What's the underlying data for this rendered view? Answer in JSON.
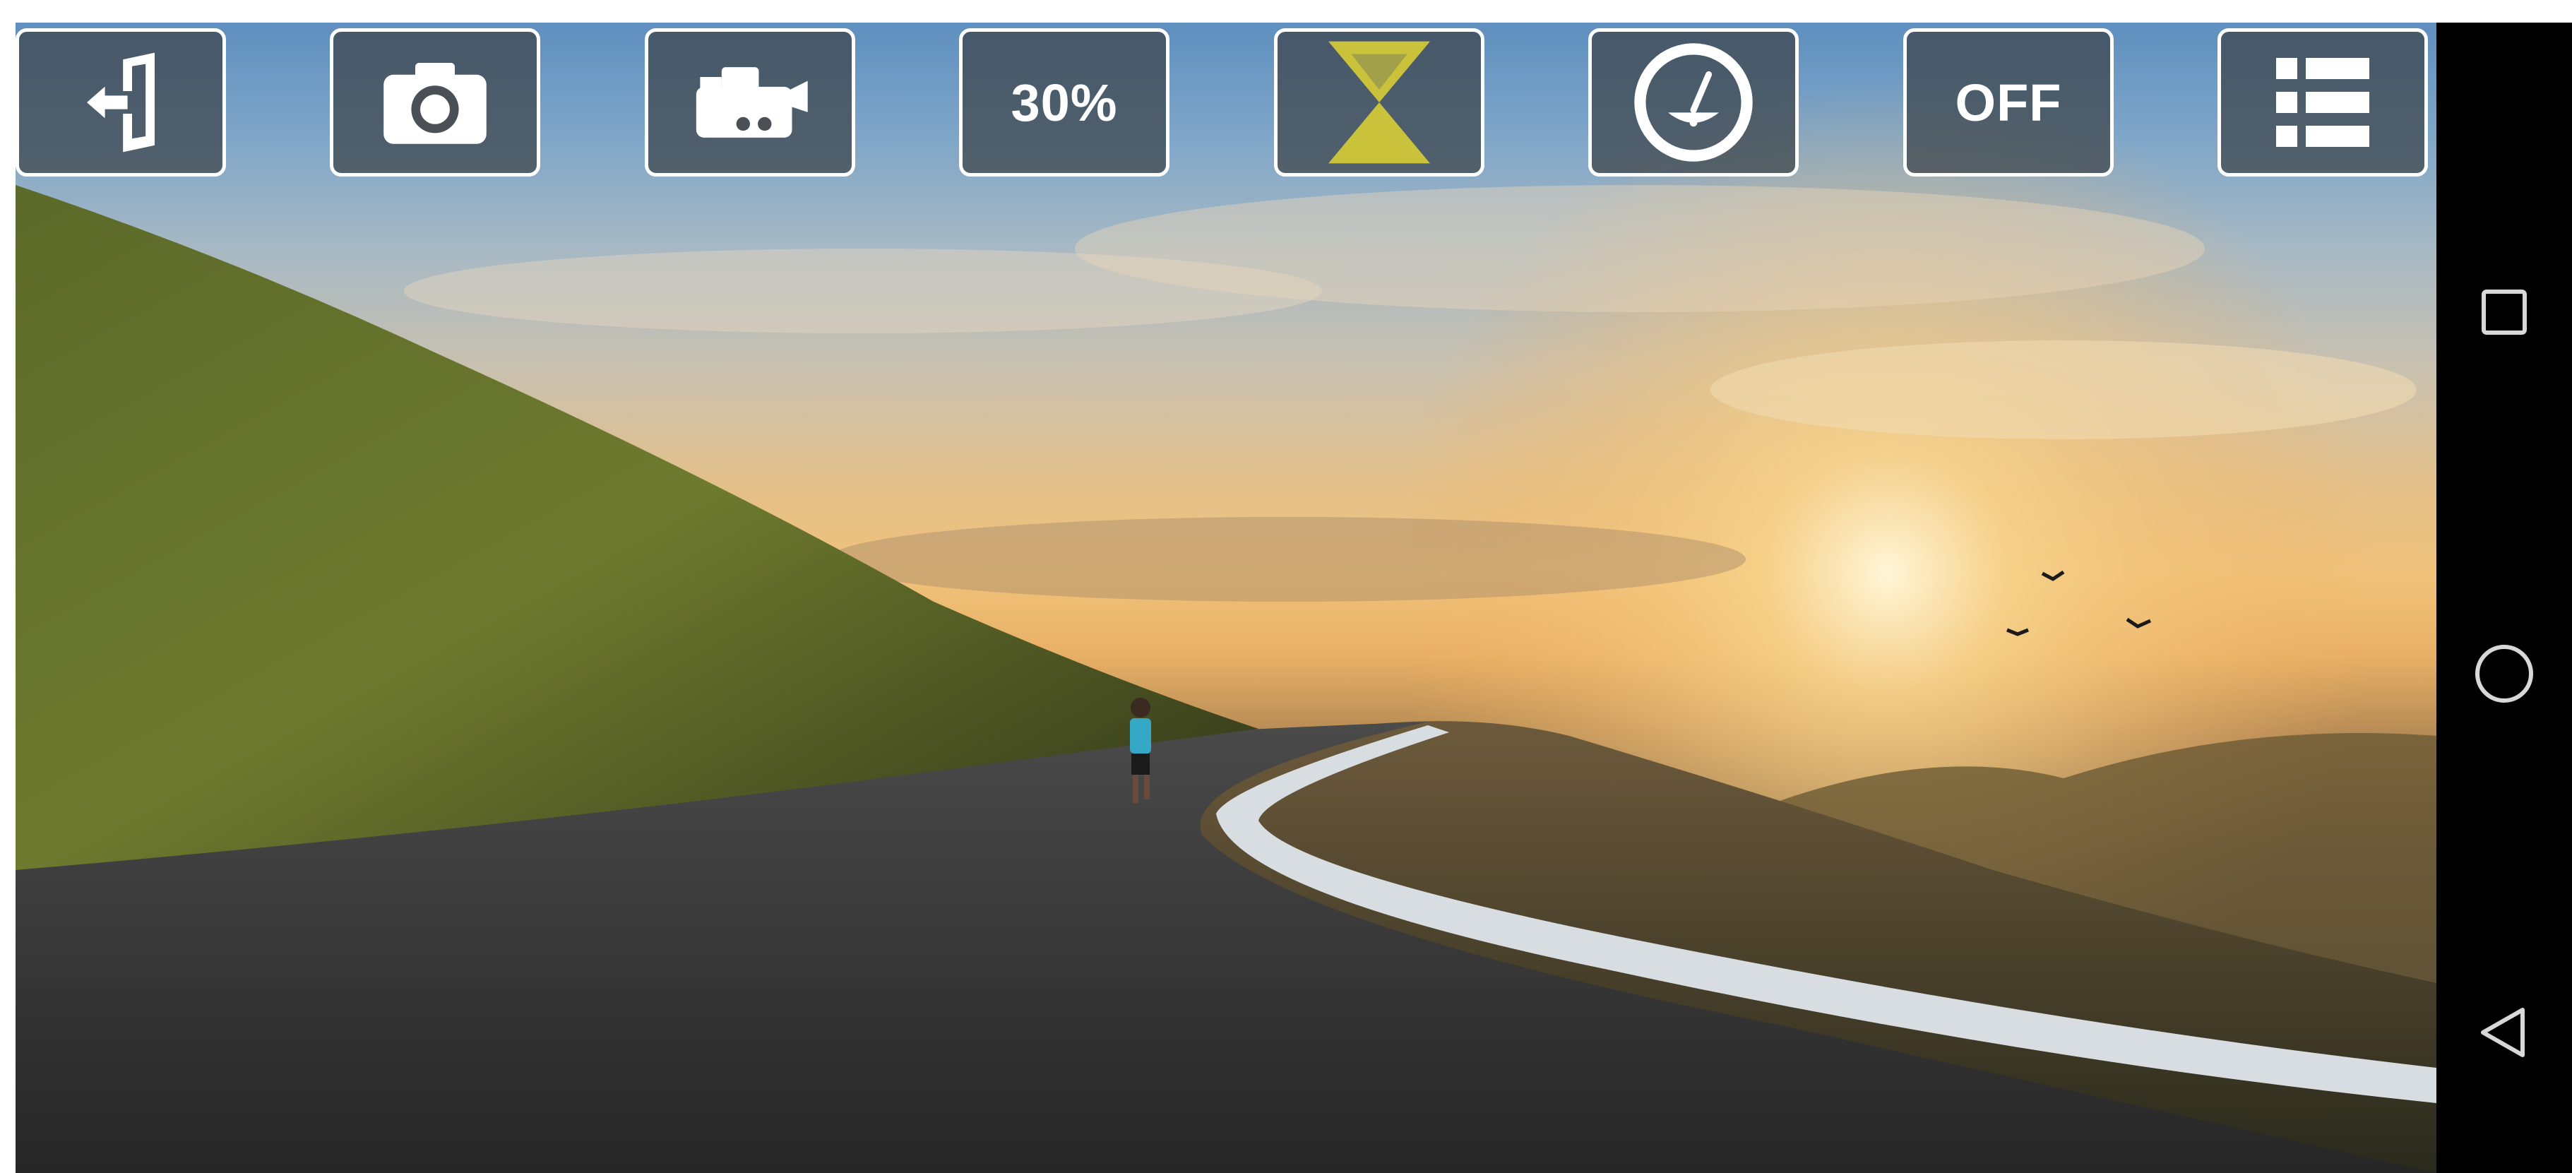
{
  "toolbar": {
    "buttons": [
      {
        "name": "exit-button",
        "icon": "exit-door-icon"
      },
      {
        "name": "photo-mode-button",
        "icon": "camera-icon"
      },
      {
        "name": "video-mode-button",
        "icon": "video-camera-icon"
      },
      {
        "name": "quality-button",
        "label": "30%"
      },
      {
        "name": "timer-button",
        "icon": "hourglass-icon",
        "icon_color": "#c9c23a"
      },
      {
        "name": "stabilizer-button",
        "icon": "level-gauge-icon"
      },
      {
        "name": "flash-toggle-button",
        "label": "OFF"
      },
      {
        "name": "menu-button",
        "icon": "list-menu-icon"
      }
    ],
    "button_background": "#3c4248",
    "button_border": "#ffffff"
  },
  "navbar": {
    "recents_icon": "square-recents-icon",
    "home_icon": "circle-home-icon",
    "back_icon": "triangle-back-icon",
    "background": "#000000",
    "icon_color": "#d8d8d8"
  },
  "preview": {
    "content": "camera-viewfinder-landscape"
  }
}
